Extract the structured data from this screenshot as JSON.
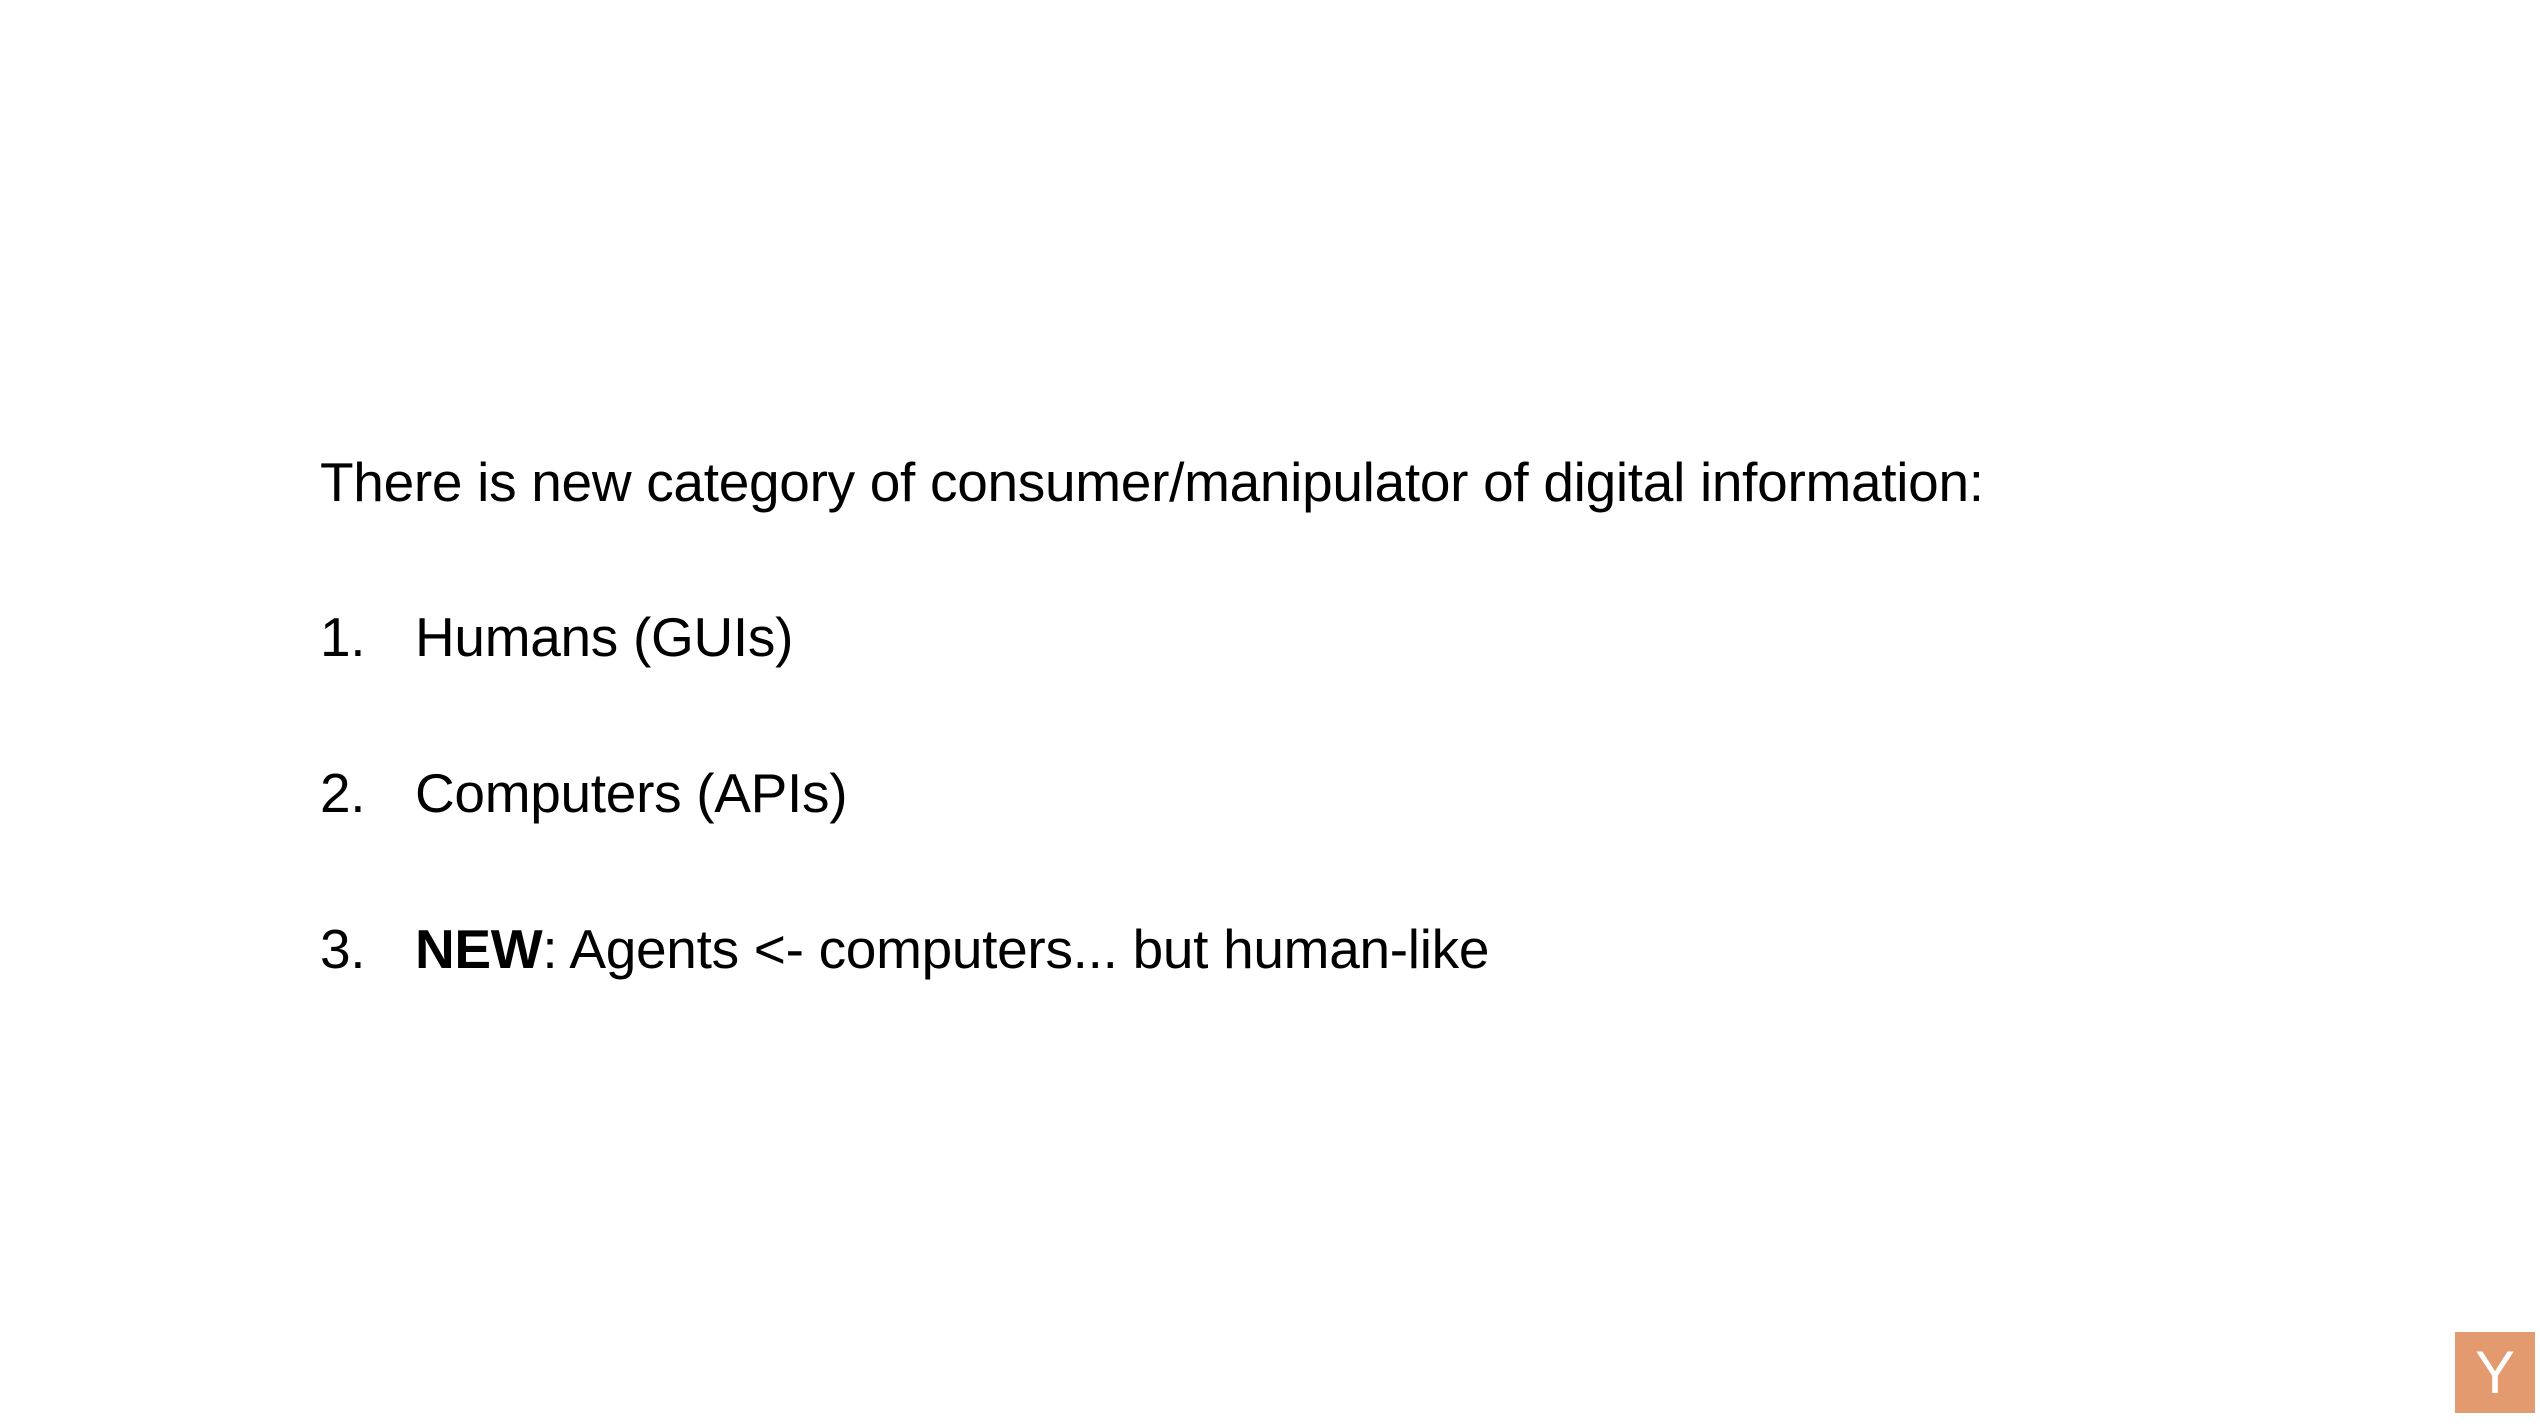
{
  "slide": {
    "heading": "There is new category of consumer/manipulator of digital information:",
    "items": [
      {
        "number": "1.",
        "bold": "",
        "text": "Humans (GUIs)"
      },
      {
        "number": "2.",
        "bold": "",
        "text": "Computers (APIs)"
      },
      {
        "number": "3.",
        "bold": "NEW",
        "text": ": Agents <- computers... but human-like"
      }
    ]
  },
  "logo": {
    "letter": "Y",
    "color": "#E49A6F"
  }
}
